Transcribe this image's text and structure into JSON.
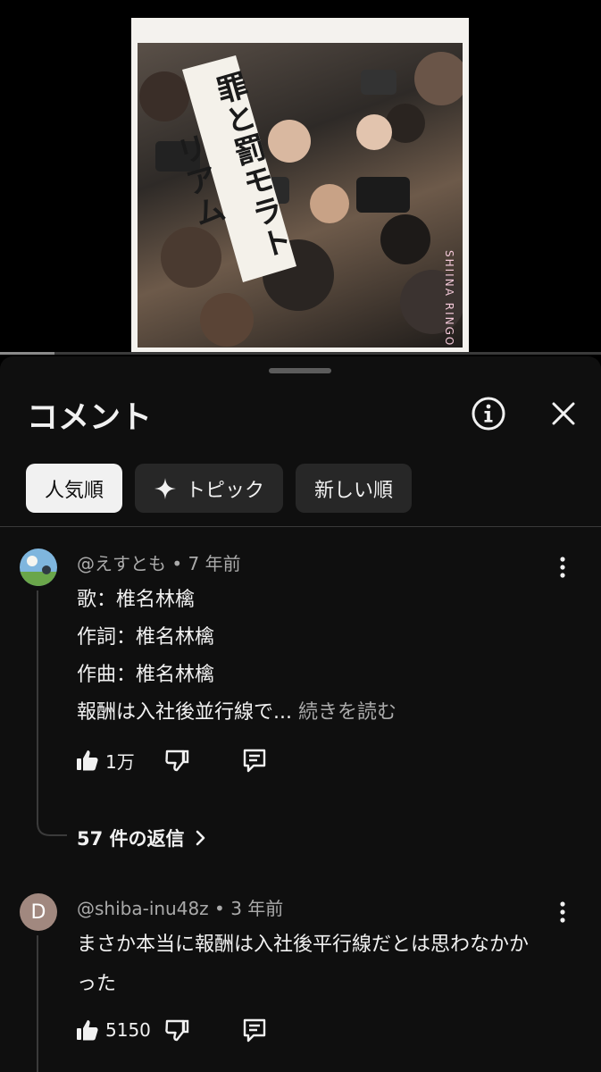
{
  "video": {
    "album_title_art": "罪と罰モラトリアム",
    "artist_art": "SHIINA RINGO",
    "progress_fraction": 0.09
  },
  "sheet": {
    "title": "コメント",
    "chips": [
      {
        "label": "人気順",
        "active": true
      },
      {
        "label": "トピック",
        "active": false
      },
      {
        "label": "新しい順",
        "active": false
      }
    ]
  },
  "comments": [
    {
      "author": "@えすとも",
      "separator": "•",
      "time": "7 年前",
      "lines": [
        "歌：椎名林檎",
        "作詞：椎名林檎",
        "作曲：椎名林檎",
        "報酬は入社後並行線で..."
      ],
      "read_more": "続きを読む",
      "likes": "1万",
      "replies_label": "57 件の返信"
    },
    {
      "author": "@shiba-inu48z",
      "separator": "•",
      "time": "3 年前",
      "avatar_letter": "D",
      "lines": [
        "まさか本当に報酬は入社後平行線だとは思わなかか",
        "った"
      ],
      "likes": "5150"
    }
  ],
  "colors": {
    "sheet_bg": "#0f0f0f",
    "chip_bg": "#272727",
    "chip_active_bg": "#f1f1f1",
    "muted": "#aaaaaa",
    "avatar_d": "#a1887f"
  }
}
